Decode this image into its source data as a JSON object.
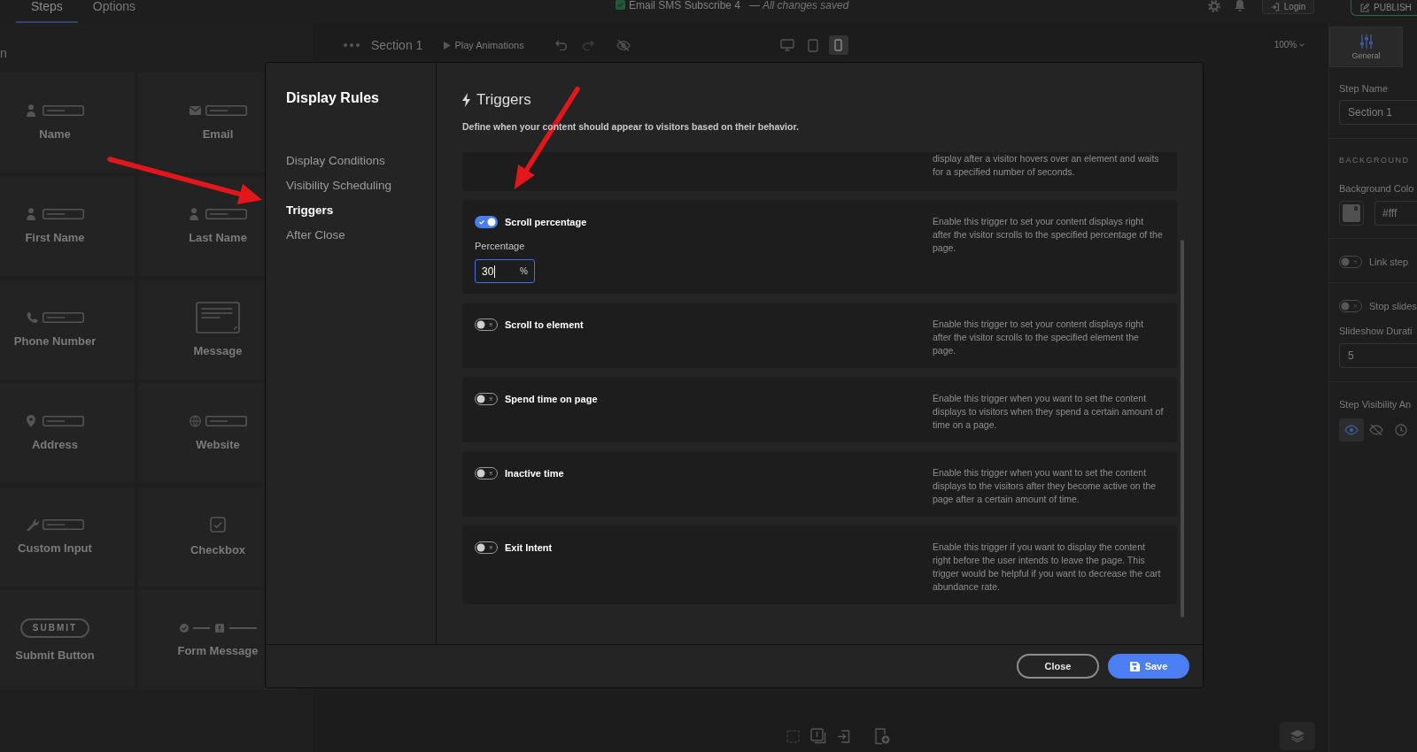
{
  "top_bar": {
    "tabs": [
      {
        "label": "Steps",
        "selected": true
      },
      {
        "label": "Options",
        "selected": false
      }
    ],
    "funnel_name": "Email SMS Subscribe 4",
    "save_status": "— All changes saved",
    "login_button": "Login",
    "publish_button": "PUBLISH"
  },
  "elements_panel": {
    "heading": "n",
    "items": [
      {
        "kind": "person",
        "label": "Name"
      },
      {
        "kind": "email",
        "label": "Email"
      },
      {
        "kind": "person",
        "label": "First Name"
      },
      {
        "kind": "person",
        "label": "Last Name"
      },
      {
        "kind": "phone",
        "label": "Phone Number"
      },
      {
        "kind": "textarea",
        "label": "Message"
      },
      {
        "kind": "address",
        "label": "Address"
      },
      {
        "kind": "website",
        "label": "Website"
      },
      {
        "kind": "custom",
        "label": "Custom Input"
      },
      {
        "kind": "checkbox",
        "label": "Checkbox"
      },
      {
        "kind": "submit",
        "label": "Submit Button",
        "button_text": "SUBMIT"
      },
      {
        "kind": "form_message",
        "label": "Form Message"
      }
    ]
  },
  "canvas_toolbar": {
    "section": "Section 1",
    "play_button": "Play Animations",
    "devices": [
      {
        "kind": "desktop",
        "selected": false
      },
      {
        "kind": "tablet",
        "selected": false
      },
      {
        "kind": "mobile",
        "selected": true
      }
    ],
    "zoom": "100%"
  },
  "settings_panel": {
    "tabs": [
      {
        "label": "General",
        "selected": true
      }
    ],
    "step_name": {
      "label": "Step Name",
      "value": "Section 1"
    },
    "background": {
      "heading": "BACKGROUND",
      "color_label": "Background Colo",
      "color_value": "#fff"
    },
    "link_step": {
      "label": "Link step",
      "on": false
    },
    "slideshow": {
      "label": "Stop slides",
      "on": false,
      "duration_label": "Slideshow Durati",
      "duration_value": "5"
    },
    "visibility": {
      "label": "Step Visibility An",
      "options": [
        {
          "kind": "visible",
          "selected": true
        },
        {
          "kind": "hidden",
          "selected": false
        },
        {
          "kind": "scheduled",
          "selected": false
        }
      ]
    }
  },
  "modal": {
    "title": "Display Rules",
    "nav": [
      {
        "label": "Display Conditions",
        "selected": false
      },
      {
        "label": "Visibility Scheduling",
        "selected": false
      },
      {
        "label": "Triggers",
        "selected": true
      },
      {
        "label": "After Close",
        "selected": false
      }
    ],
    "heading": "Triggers",
    "description": "Define when your content should appear to visitors based on their behavior.",
    "clipped_trigger": {
      "description": "display after a visitor hovers over an element and waits for a specified number of seconds."
    },
    "triggers": [
      {
        "title": "Scroll percentage",
        "on": true,
        "description": "Enable this trigger to set your content displays right after the visitor scrolls to the specified percentage of the page.",
        "field": {
          "label": "Percentage",
          "value": "30",
          "unit": "%",
          "focused": true
        }
      },
      {
        "title": "Scroll to element",
        "on": false,
        "description": "Enable this trigger to set your content displays right after the visitor scrolls to the specified element the page."
      },
      {
        "title": "Spend time on page",
        "on": false,
        "description": "Enable this trigger when you want to set the content displays to visitors when they spend a certain amount of time on a page."
      },
      {
        "title": "Inactive time",
        "on": false,
        "description": "Enable this trigger when you want to set the content displays to the visitors after they become active on the page after a certain amount of time."
      },
      {
        "title": "Exit Intent",
        "on": false,
        "description": "Enable this trigger if you want to display the content right before the user intends to leave the page. This trigger would be helpful if you want to decrease the cart abundance rate."
      }
    ],
    "buttons": [
      {
        "label": "Close",
        "kind": "secondary"
      },
      {
        "label": "Save",
        "kind": "primary"
      }
    ]
  }
}
